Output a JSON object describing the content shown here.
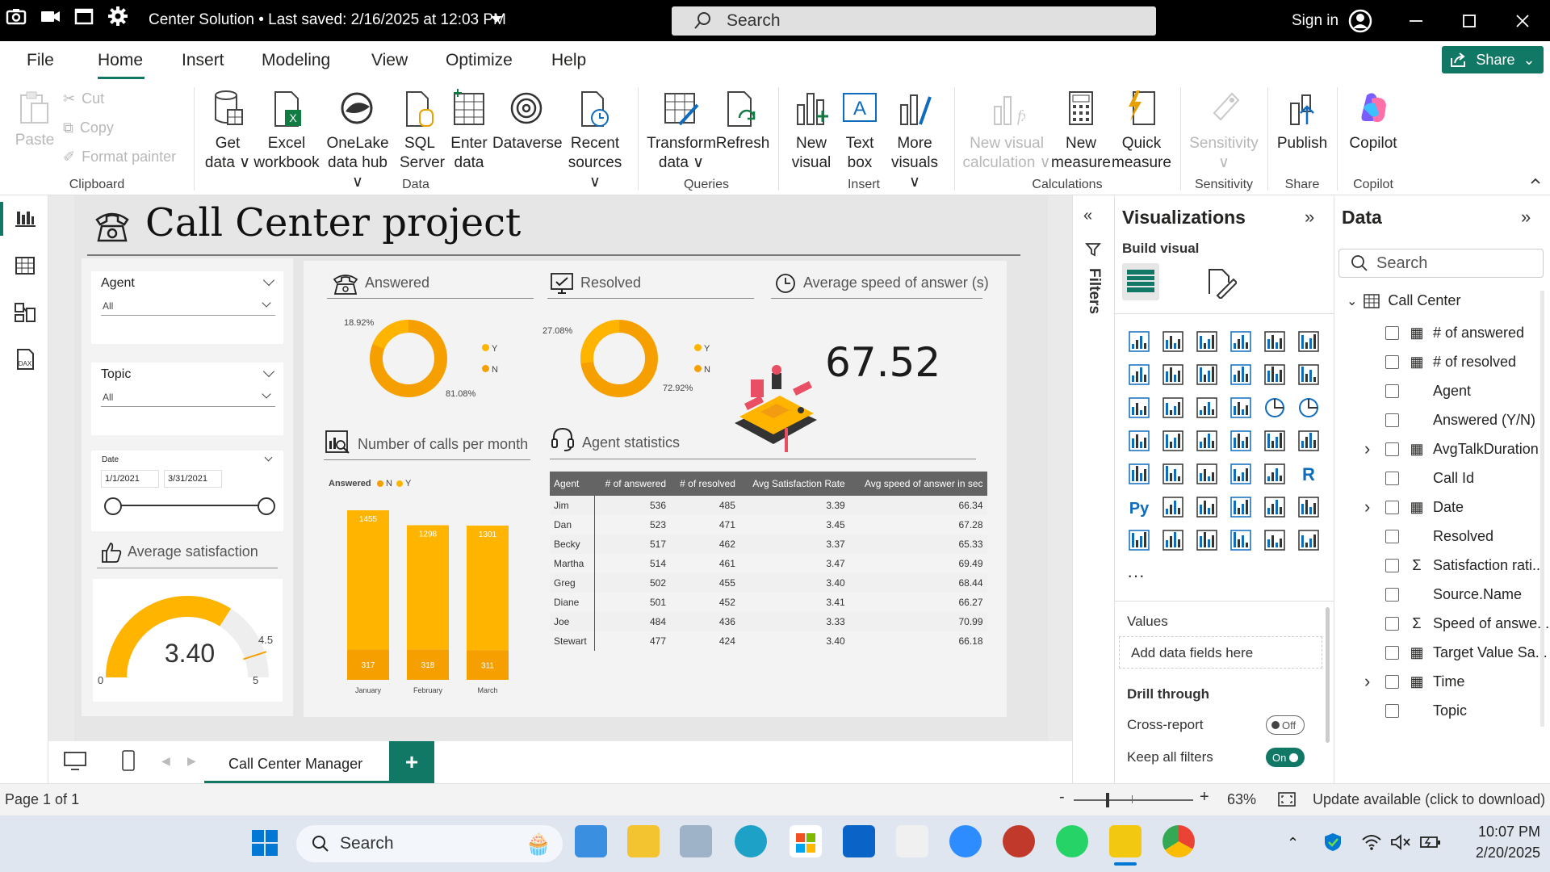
{
  "window": {
    "title": "Center Solution  •  Last saved: 2/16/2025 at 12:03 PM",
    "search_placeholder": "Search",
    "sign_in": "Sign in",
    "capture_icons": [
      "camera-icon",
      "video-icon",
      "window-icon",
      "gear-icon"
    ]
  },
  "menu": {
    "tabs": [
      "File",
      "Home",
      "Insert",
      "Modeling",
      "View",
      "Optimize",
      "Help"
    ],
    "active": "Home",
    "share": "Share"
  },
  "ribbon": {
    "clipboard": {
      "paste": "Paste",
      "cut": "Cut",
      "copy": "Copy",
      "format_painter": "Format painter",
      "group": "Clipboard"
    },
    "data": {
      "get_data": [
        "Get",
        "data ∨"
      ],
      "excel": [
        "Excel",
        "workbook"
      ],
      "onelake": [
        "OneLake",
        "data hub ∨"
      ],
      "sql": [
        "SQL",
        "Server"
      ],
      "enter": [
        "Enter",
        "data"
      ],
      "dataverse": [
        "Dataverse",
        ""
      ],
      "recent": [
        "Recent",
        "sources ∨"
      ],
      "group": "Data"
    },
    "queries": {
      "transform": [
        "Transform",
        "data ∨"
      ],
      "refresh": [
        "Refresh",
        ""
      ],
      "group": "Queries"
    },
    "insert": {
      "new_visual": [
        "New",
        "visual"
      ],
      "text_box": [
        "Text",
        "box"
      ],
      "more_visuals": [
        "More",
        "visuals ∨"
      ],
      "group": "Insert"
    },
    "calculations": {
      "new_visual_calc": [
        "New visual",
        "calculation ∨"
      ],
      "new_measure": [
        "New",
        "measure"
      ],
      "quick_measure": [
        "Quick",
        "measure"
      ],
      "group": "Calculations"
    },
    "sensitivity": {
      "label": [
        "Sensitivity",
        "∨"
      ],
      "group": "Sensitivity"
    },
    "share": {
      "publish": "Publish",
      "group": "Share"
    },
    "copilot": {
      "label": "Copilot",
      "group": "Copilot"
    }
  },
  "report": {
    "title": "Call Center project",
    "slicers": {
      "agent": {
        "label": "Agent",
        "value": "All"
      },
      "topic": {
        "label": "Topic",
        "value": "All"
      },
      "date": {
        "label": "Date",
        "start": "1/1/2021",
        "end": "3/31/2021"
      }
    },
    "avg_satisfaction": {
      "title": "Average satisfaction",
      "value": "3.40",
      "min": "0",
      "max": "5",
      "target": "4.5",
      "value_num": 3.4
    },
    "answered": {
      "title": "Answered",
      "pct_small": "18.92%",
      "pct_large": "81.08%",
      "legend": [
        "Y",
        "N"
      ],
      "small_share": 0.1892
    },
    "resolved": {
      "title": "Resolved",
      "pct_small": "27.08%",
      "pct_large": "72.92%",
      "legend": [
        "Y",
        "N"
      ],
      "small_share": 0.2708
    },
    "speed": {
      "title": "Average speed of answer (s)",
      "value": "67.52"
    },
    "calls_per_month": {
      "title": "Number of calls per month",
      "legend_title": "Answered",
      "legend": [
        "N",
        "Y"
      ]
    },
    "agent_stats": {
      "title": "Agent statistics",
      "columns": [
        "Agent",
        "# of answered",
        "# of resolved",
        "Avg Satisfaction Rate",
        "Avg speed of answer in sec"
      ],
      "rows": [
        [
          "Jim",
          "536",
          "485",
          "3.39",
          "66.34"
        ],
        [
          "Dan",
          "523",
          "471",
          "3.45",
          "67.28"
        ],
        [
          "Becky",
          "517",
          "462",
          "3.37",
          "65.33"
        ],
        [
          "Martha",
          "514",
          "461",
          "3.47",
          "69.49"
        ],
        [
          "Greg",
          "502",
          "455",
          "3.40",
          "68.44"
        ],
        [
          "Diane",
          "501",
          "452",
          "3.41",
          "66.27"
        ],
        [
          "Joe",
          "484",
          "436",
          "3.33",
          "70.99"
        ],
        [
          "Stewart",
          "477",
          "424",
          "3.40",
          "66.18"
        ]
      ]
    }
  },
  "chart_data": {
    "type": "bar",
    "title": "Number of calls per month",
    "categories": [
      "January",
      "February",
      "March"
    ],
    "series": [
      {
        "name": "Y",
        "values": [
          1455,
          1298,
          1301
        ],
        "color": "#ffb400"
      },
      {
        "name": "N",
        "values": [
          317,
          318,
          311
        ],
        "color": "#f5a000"
      }
    ],
    "stacked": true,
    "legend": "top-left"
  },
  "panes": {
    "filters": "Filters",
    "visualizations": {
      "title": "Visualizations",
      "build": "Build visual",
      "values": "Values",
      "add_fields": "Add data fields here",
      "drill": "Drill through",
      "cross_report": "Cross-report",
      "cross_state": "Off",
      "keep_filters": "Keep all filters",
      "keep_state": "On"
    },
    "data": {
      "title": "Data",
      "search_placeholder": "Search",
      "table": "Call Center",
      "fields": [
        "# of answered",
        "# of resolved",
        "Agent",
        "Answered (Y/N)",
        "AvgTalkDuration",
        "Call Id",
        "Date",
        "Resolved",
        "Satisfaction rati...",
        "Source.Name",
        "Speed of answe...",
        "Target Value Sa...",
        "Time",
        "Topic"
      ]
    }
  },
  "footer": {
    "page_tab": "Call Center Manager",
    "add_page": "+",
    "page_info": "Page 1 of 1",
    "zoom": "63%",
    "update": "Update available (click to download)"
  },
  "taskbar": {
    "search": "Search",
    "time": "10:07 PM",
    "date": "2/20/2025"
  },
  "colors": {
    "accent": "#117865",
    "yes": "#ffb400",
    "no": "#f5a000",
    "gauge": "#ffb400"
  }
}
